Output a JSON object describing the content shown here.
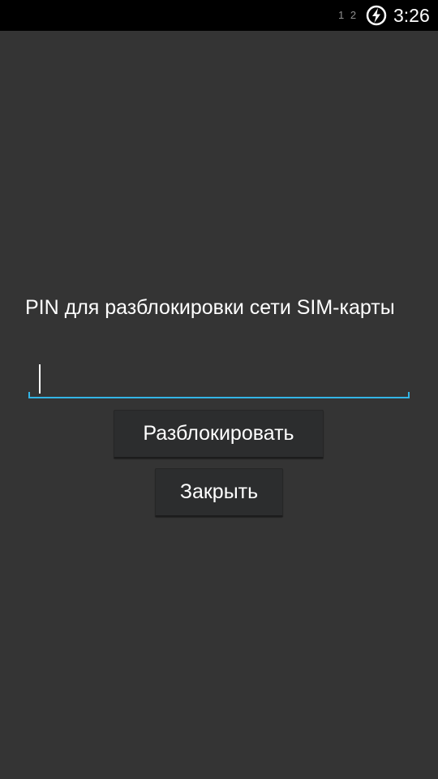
{
  "status_bar": {
    "sim_indicators": "1 2",
    "battery_icon": "battery-charging-icon",
    "time": "3:26"
  },
  "dialog": {
    "prompt": "PIN для разблокировки сети SIM-карты",
    "pin_input": {
      "value": "",
      "placeholder": ""
    },
    "unlock_label": "Разблокировать",
    "close_label": "Закрыть"
  },
  "colors": {
    "background": "#343434",
    "status_bar": "#000000",
    "accent": "#33b5e5",
    "button": "#2c2d2e"
  }
}
